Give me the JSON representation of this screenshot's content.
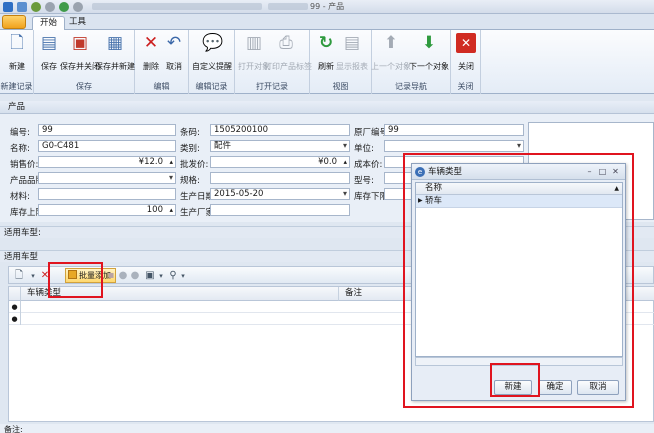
{
  "window": {
    "title": "99 - 产品"
  },
  "tabs": [
    {
      "label": "开始"
    },
    {
      "label": "工具"
    }
  ],
  "ribbon": {
    "groups": {
      "new_record": "新建记录",
      "save": "保存",
      "edit": "编辑",
      "edit_records": "编辑记录",
      "print_records": "打开记录",
      "view": "视图",
      "record_nav": "记录导航",
      "close": "关闭"
    },
    "buttons": {
      "new": "新建",
      "save": "保存",
      "save_close": "保存并关闭",
      "save_new": "保存并新建",
      "delete": "删除",
      "cancel": "取消",
      "custom_tip": "自定义提醒",
      "open_object": "打开对象",
      "print_label": "打印产品标签",
      "refresh": "刷新",
      "show_report": "显示报表",
      "prev_object": "上一个对象",
      "next_object": "下一个对象",
      "close": "关闭"
    }
  },
  "form": {
    "panel_title": "产品",
    "labels": {
      "code": "编号:",
      "name": "名称:",
      "sale_price": "销售价:",
      "brand": "产品品牌:",
      "material": "材料:",
      "stock_max": "库存上限:",
      "barcode": "条码:",
      "category": "类别:",
      "wholesale": "批发价:",
      "spec": "规格:",
      "prod_date": "生产日期:",
      "maker": "生产厂家:",
      "factory_code": "原厂编号:",
      "unit": "单位:",
      "cost": "成本价:",
      "model": "型号:",
      "stock_min": "库存下限:"
    },
    "values": {
      "code": "99",
      "name": "G0-C481",
      "sale_price": "¥12.0",
      "stock_max": "100",
      "barcode": "1505200100",
      "category": "配件",
      "wholesale": "¥0.0",
      "prod_date": "2015-05-20",
      "factory_code": "99"
    }
  },
  "applicable_label": "适用车型:",
  "subpanel_title": "适用车型",
  "toolbar": {
    "batch_add": "批量添加"
  },
  "grid": {
    "columns": [
      "车辆类型",
      "备注"
    ]
  },
  "remark_label": "备注:",
  "dialog": {
    "title": "车辆类型",
    "column": "名称",
    "rows": [
      "轿车"
    ],
    "buttons": {
      "new": "新建",
      "ok": "确定",
      "cancel": "取消"
    }
  },
  "colors": {
    "highlight": "#e0141f",
    "accent": "#f0a21d"
  }
}
